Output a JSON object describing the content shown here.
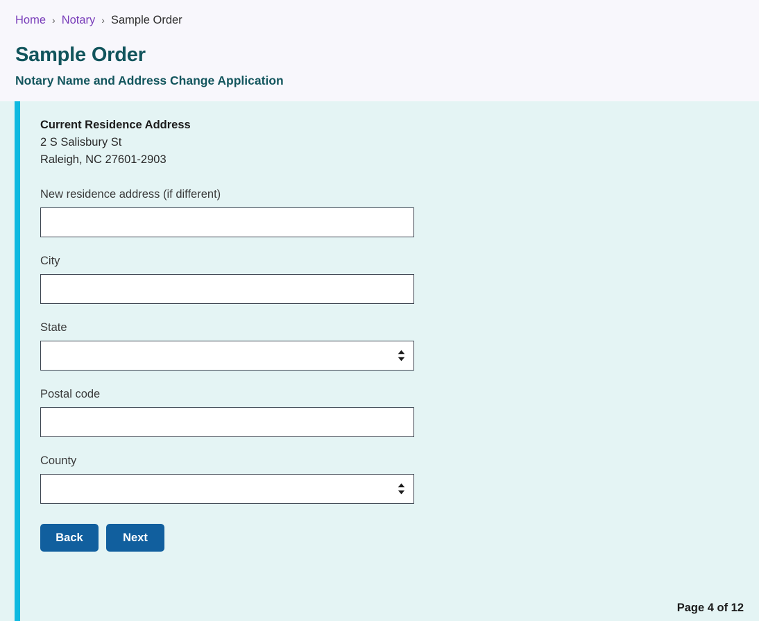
{
  "breadcrumb": {
    "items": [
      {
        "label": "Home",
        "link": true
      },
      {
        "label": "Notary",
        "link": true
      },
      {
        "label": "Sample Order",
        "link": false
      }
    ],
    "separator": "›"
  },
  "header": {
    "title": "Sample Order",
    "subtitle": "Notary Name and Address Change Application"
  },
  "form": {
    "current_address": {
      "heading": "Current Residence Address",
      "line1": "2 S Salisbury St",
      "line2": "Raleigh, NC 27601-2903"
    },
    "fields": [
      {
        "label": "New residence address (if different)",
        "type": "text",
        "value": "",
        "placeholder": "",
        "name": "new-residence-address"
      },
      {
        "label": "City",
        "type": "text",
        "value": "",
        "placeholder": "",
        "name": "city"
      },
      {
        "label": "State",
        "type": "select",
        "value": "",
        "options": [
          ""
        ],
        "name": "state"
      },
      {
        "label": "Postal code",
        "type": "text",
        "value": "",
        "placeholder": "",
        "name": "postal-code"
      },
      {
        "label": "County",
        "type": "select",
        "value": "",
        "options": [
          ""
        ],
        "name": "county"
      }
    ],
    "buttons": {
      "back": "Back",
      "next": "Next"
    },
    "page_counter": "Page 4 of 12"
  },
  "colors": {
    "page_background": "#f8f7fc",
    "panel_background": "#e4f4f4",
    "accent_bar": "#0fb9e0",
    "heading": "#11545c",
    "link": "#783cb9",
    "button": "#115f9e",
    "input_border": "#3d4551"
  }
}
